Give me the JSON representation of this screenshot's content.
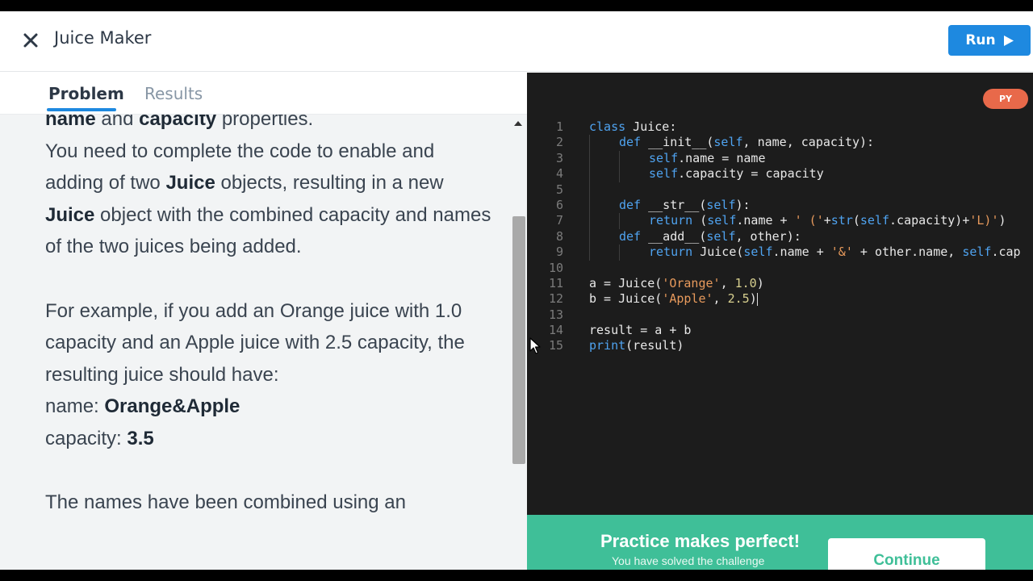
{
  "header": {
    "title": "Juice Maker",
    "run_label": "Run"
  },
  "tabs": [
    {
      "label": "Problem",
      "active": true
    },
    {
      "label": "Results",
      "active": false
    }
  ],
  "problem": {
    "p1": {
      "b1": "name",
      "t1": " and ",
      "b2": "capacity",
      "t2": " properties."
    },
    "p2": {
      "t1": "You need to complete the code to enable and adding of two ",
      "b1": "Juice",
      "t2": " objects, resulting in a new ",
      "b2": "Juice",
      "t3": " object with the combined capacity and names of the two juices being added."
    },
    "p3": "For example, if you add an Orange juice with 1.0 capacity and an Apple juice with 2.5 capacity, the resulting juice should have:",
    "p4": {
      "label": "name: ",
      "value": "Orange&Apple"
    },
    "p5": {
      "label": "capacity: ",
      "value": "3.5"
    },
    "p6": "The names have been combined using an"
  },
  "editor": {
    "language_badge": "PY",
    "line_numbers": [
      "1",
      "2",
      "3",
      "4",
      "5",
      "6",
      "7",
      "8",
      "9",
      "10",
      "11",
      "12",
      "13",
      "14",
      "15"
    ],
    "tokens": {
      "l1": [
        "class",
        " Juice:"
      ],
      "l2": [
        "def",
        " __init__(",
        "self",
        ", name, capacity):"
      ],
      "l3": [
        "self",
        ".name = name"
      ],
      "l4": [
        "self",
        ".capacity = capacity"
      ],
      "l6": [
        "def",
        " __str__(",
        "self",
        "):"
      ],
      "l7": [
        "return",
        " (",
        "self",
        ".name + ",
        "' ('",
        "+",
        "str",
        "(",
        "self",
        ".capacity)+",
        "'L)'",
        ")"
      ],
      "l8": [
        "def",
        " __add__(",
        "self",
        ", other):"
      ],
      "l9": [
        "return",
        " Juice(",
        "self",
        ".name + ",
        "'&'",
        " + other.name, ",
        "self",
        ".cap"
      ],
      "l11": [
        "a = Juice(",
        "'Orange'",
        ", ",
        "1.0",
        ")"
      ],
      "l12": [
        "b = Juice(",
        "'Apple'",
        ", ",
        "2.5",
        ")"
      ],
      "l14": [
        "result = a + b"
      ],
      "l15": [
        "print",
        "(result)"
      ]
    }
  },
  "banner": {
    "title": "Practice makes perfect!",
    "subtitle": "You have solved the challenge",
    "continue_label": "Continue"
  },
  "colors": {
    "accent": "#1e89e0",
    "success": "#3fbf98",
    "badge": "#e8694a",
    "editor_bg": "#1c1c1c"
  }
}
